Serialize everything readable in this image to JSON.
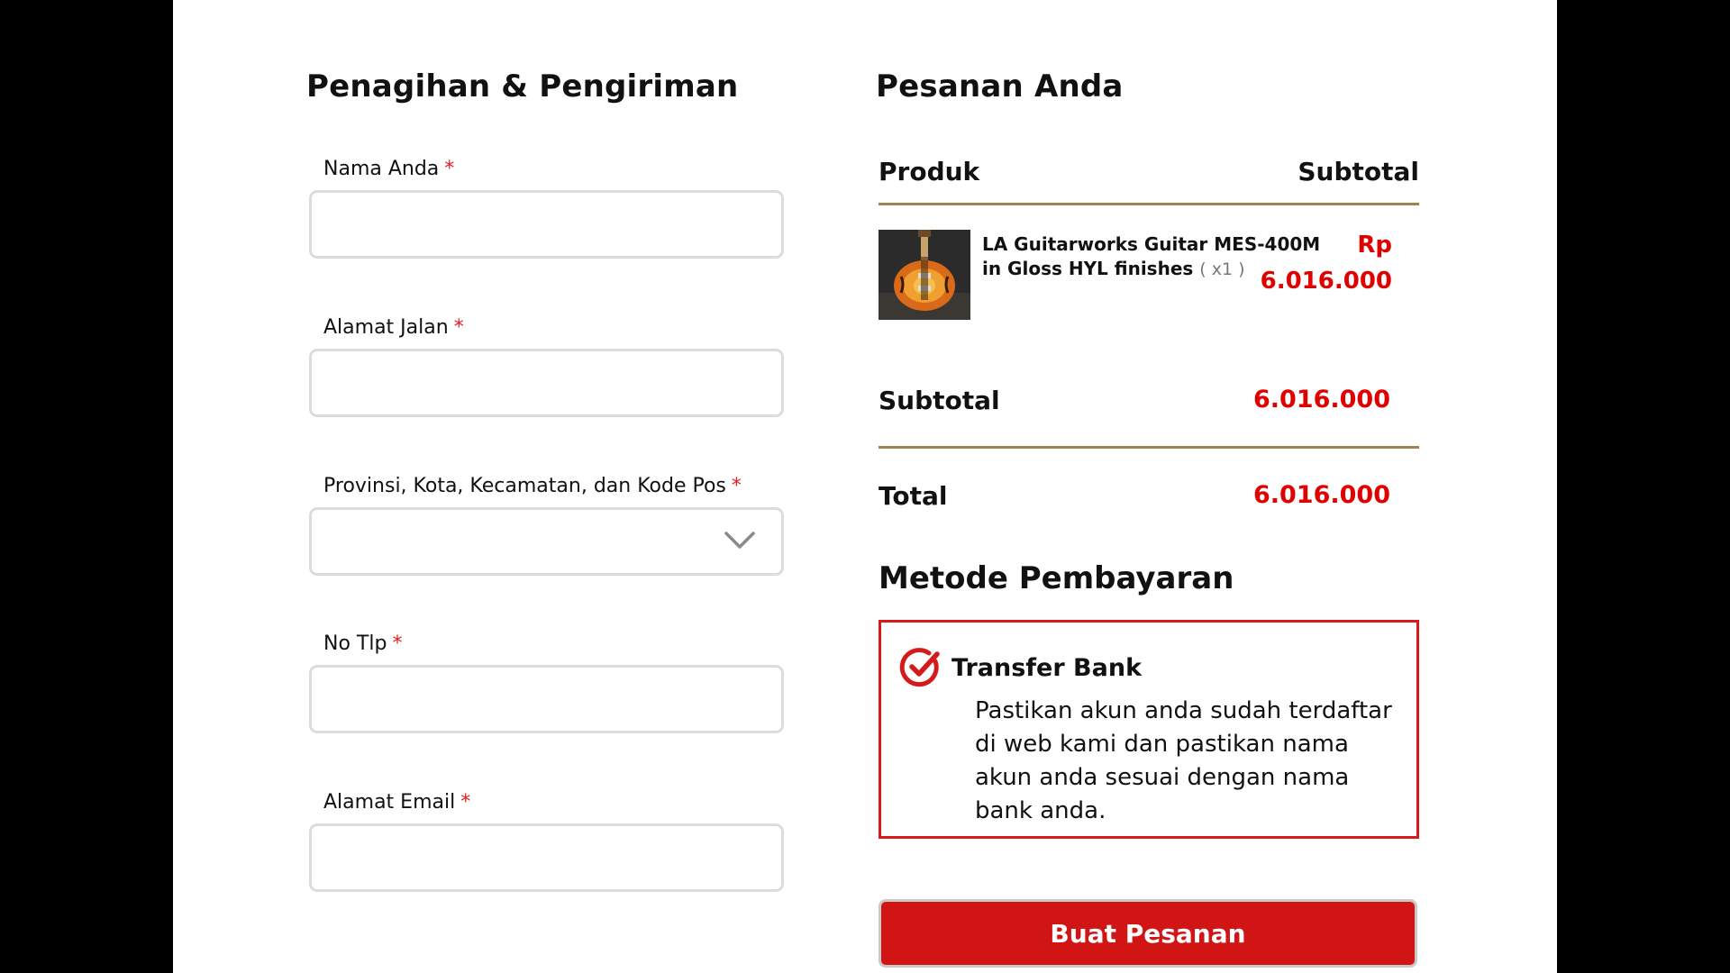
{
  "billing": {
    "title": "Penagihan & Pengiriman",
    "fields": [
      {
        "label": "Nama Anda",
        "required": "*",
        "value": ""
      },
      {
        "label": "Alamat Jalan",
        "required": "*",
        "value": ""
      },
      {
        "label": "Provinsi, Kota, Kecamatan, dan Kode Pos",
        "required": "*",
        "value": ""
      },
      {
        "label": "No Tlp",
        "required": "*",
        "value": ""
      },
      {
        "label": "Alamat Email",
        "required": "*",
        "value": ""
      }
    ]
  },
  "order": {
    "title": "Pesanan Anda",
    "col_product": "Produk",
    "col_subtotal": "Subtotal",
    "item": {
      "name": "LA Guitarworks Guitar MES-400M in Gloss HYL finishes",
      "qty": "( x1 )",
      "currency": "Rp",
      "price": "6.016.000",
      "image_icon": "guitar-image"
    },
    "subtotal_label": "Subtotal",
    "subtotal_value": "6.016.000",
    "total_label": "Total",
    "total_value": "6.016.000"
  },
  "payment": {
    "title": "Metode Pembayaran",
    "method_name": "Transfer Bank",
    "method_desc": "Pastikan akun anda sudah terdaftar di web kami dan pastikan nama akun anda sesuai dengan nama bank anda.",
    "check_icon": "check-circle-icon",
    "accent_color": "#d41a1a"
  },
  "submit_label": "Buat Pesanan",
  "colors": {
    "price": "#e00000",
    "divider": "#9b8651",
    "button": "#d11515"
  }
}
